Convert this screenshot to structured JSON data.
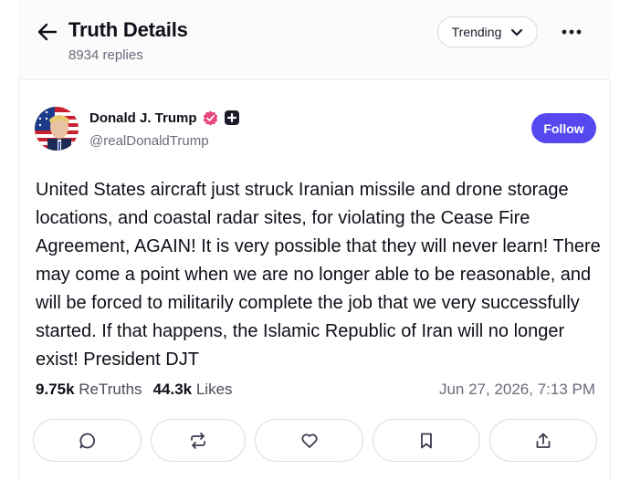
{
  "header": {
    "title": "Truth Details",
    "reply_count": "8934 replies",
    "sort_label": "Trending",
    "icons": {
      "back": "arrow-left-icon",
      "sort": "chevron-down-icon",
      "more": "more-horizontal-icon"
    }
  },
  "post": {
    "author_name": "Donald J. Trump",
    "handle": "@realDonaldTrump",
    "follow_label": "Follow",
    "text": "United States aircraft just struck Iranian missile and drone storage locations, and coastal radar sites, for violating the Cease Fire Agreement, AGAIN! It is very possible that they will never learn! There may come a point when we are no longer able to be reasonable, and will be forced to militarily complete the job that we very successfully started. If that happens, the Islamic Republic of Iran will no longer exist! President DJT",
    "retruths_count": "9.75k",
    "retruths_label": "ReTruths",
    "likes_count": "44.3k",
    "likes_label": "Likes",
    "timestamp": "Jun 27, 2026, 7:13 PM",
    "badges": [
      "verified-badge-icon",
      "plus-badge-icon"
    ]
  },
  "actions": [
    "reply-icon",
    "retruth-icon",
    "like-icon",
    "bookmark-icon",
    "share-icon"
  ],
  "colors": {
    "accent": "#5448ee",
    "verified": "#e9467a",
    "text_primary": "#0f0f1a",
    "text_secondary": "#6b6b7b",
    "border": "#dcdce3"
  }
}
